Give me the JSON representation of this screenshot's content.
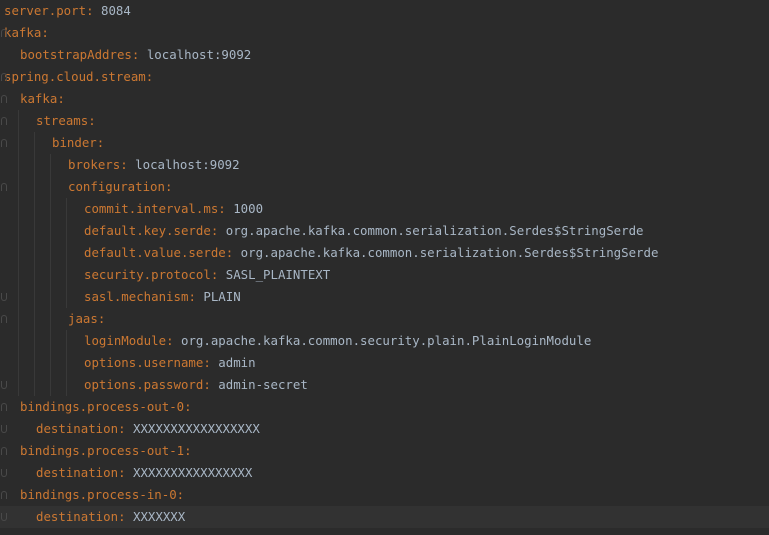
{
  "editor": {
    "language": "yaml",
    "lines": [
      {
        "key": "server.port",
        "value": "8084"
      },
      {
        "key": "kafka",
        "value": ""
      },
      {
        "key": "bootstrapAddres",
        "value": "localhost:9092"
      },
      {
        "key": "spring.cloud.stream",
        "value": ""
      },
      {
        "key": "kafka",
        "value": ""
      },
      {
        "key": "streams",
        "value": ""
      },
      {
        "key": "binder",
        "value": ""
      },
      {
        "key": "brokers",
        "value": "localhost:9092"
      },
      {
        "key": "configuration",
        "value": ""
      },
      {
        "key": "commit.interval.ms",
        "value": "1000"
      },
      {
        "key": "default.key.serde",
        "value": "org.apache.kafka.common.serialization.Serdes$StringSerde"
      },
      {
        "key": "default.value.serde",
        "value": "org.apache.kafka.common.serialization.Serdes$StringSerde"
      },
      {
        "key": "security.protocol",
        "value": "SASL_PLAINTEXT"
      },
      {
        "key": "sasl.mechanism",
        "value": "PLAIN"
      },
      {
        "key": "jaas",
        "value": ""
      },
      {
        "key": "loginModule",
        "value": "org.apache.kafka.common.security.plain.PlainLoginModule"
      },
      {
        "key": "options.username",
        "value": "admin"
      },
      {
        "key": "options.password",
        "value": "admin-secret"
      },
      {
        "key": "bindings.process-out-0",
        "value": ""
      },
      {
        "key": "destination",
        "value": "XXXXXXXXXXXXXXXXX"
      },
      {
        "key": "bindings.process-out-1",
        "value": ""
      },
      {
        "key": "destination",
        "value": "XXXXXXXXXXXXXXXX"
      },
      {
        "key": "bindings.process-in-0",
        "value": ""
      },
      {
        "key": "destination",
        "value": "XXXXXXX"
      }
    ]
  },
  "colors": {
    "background": "#2b2b2b",
    "key": "#cc7832",
    "value": "#a9b7c6",
    "current_line": "#323232"
  }
}
